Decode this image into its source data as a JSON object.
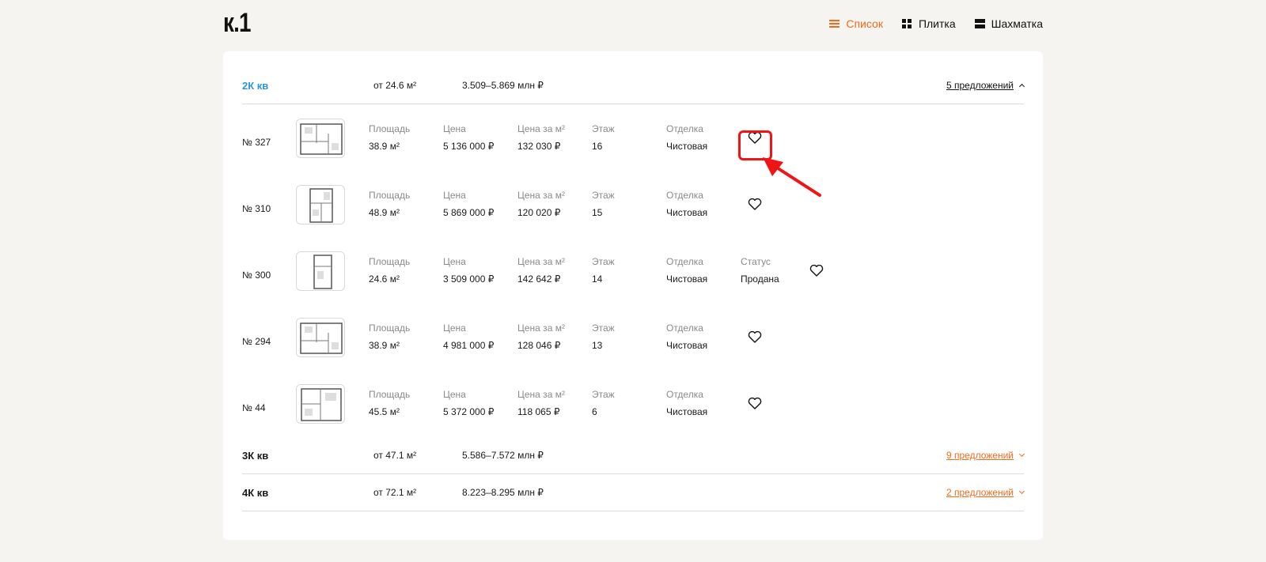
{
  "header": {
    "logo": "к.1",
    "views": [
      {
        "label": "Список",
        "icon": "list-icon",
        "active": true
      },
      {
        "label": "Плитка",
        "icon": "tile-icon",
        "active": false
      },
      {
        "label": "Шахматка",
        "icon": "chess-icon",
        "active": false
      }
    ]
  },
  "groups": [
    {
      "name": "2К кв",
      "area": "от 24.6 м²",
      "price": "3.509–5.869 млн ₽",
      "offers": "5 предложений",
      "expanded": true,
      "apartments": [
        {
          "number": "№ 327",
          "area": "38.9 м²",
          "price": "5 136 000 ₽",
          "price_m2": "132 030 ₽",
          "floor": "16",
          "finish": "Чистовая",
          "status": ""
        },
        {
          "number": "№ 310",
          "area": "48.9 м²",
          "price": "5 869 000 ₽",
          "price_m2": "120 020 ₽",
          "floor": "15",
          "finish": "Чистовая",
          "status": ""
        },
        {
          "number": "№ 300",
          "area": "24.6 м²",
          "price": "3 509 000 ₽",
          "price_m2": "142 642 ₽",
          "floor": "14",
          "finish": "Чистовая",
          "status": "Продана"
        },
        {
          "number": "№ 294",
          "area": "38.9 м²",
          "price": "4 981 000 ₽",
          "price_m2": "128 046 ₽",
          "floor": "13",
          "finish": "Чистовая",
          "status": ""
        },
        {
          "number": "№ 44",
          "area": "45.5 м²",
          "price": "5 372 000 ₽",
          "price_m2": "118 065 ₽",
          "floor": "6",
          "finish": "Чистовая",
          "status": ""
        }
      ]
    },
    {
      "name": "3К кв",
      "area": "от 47.1 м²",
      "price": "5.586–7.572 млн ₽",
      "offers": "9 предложений",
      "expanded": false
    },
    {
      "name": "4К кв",
      "area": "от 72.1 м²",
      "price": "8.223–8.295 млн ₽",
      "offers": "2 предложений",
      "expanded": false
    }
  ],
  "labels": {
    "area": "Площадь",
    "price": "Цена",
    "price_m2": "Цена за м²",
    "floor": "Этаж",
    "finish": "Отделка",
    "status": "Статус"
  },
  "colors": {
    "accent": "#f26a1b",
    "link": "#2b97d9",
    "highlight": "#f01414",
    "background": "#f5f4f0"
  }
}
